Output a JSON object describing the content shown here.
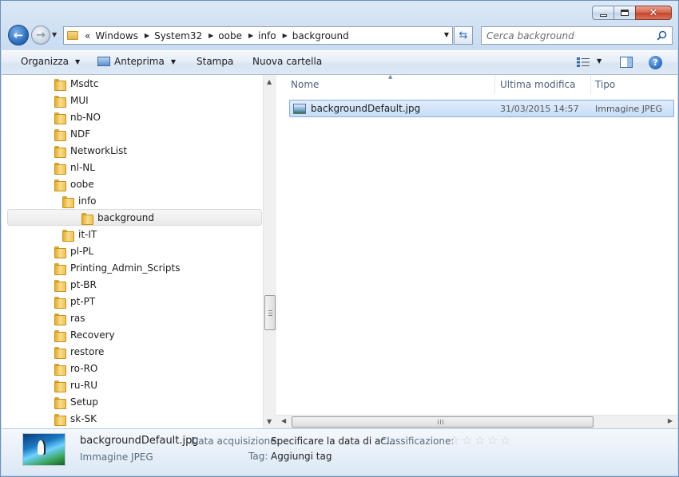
{
  "window": {
    "caption": {
      "minimize": "minimize",
      "maximize": "maximize",
      "close": "✕"
    }
  },
  "address": {
    "overflow": "«",
    "crumbs": [
      "Windows",
      "System32",
      "oobe",
      "info",
      "background"
    ]
  },
  "search": {
    "placeholder": "Cerca background"
  },
  "toolbar": {
    "organize": "Organizza",
    "preview": "Anteprima",
    "print": "Stampa",
    "new_folder": "Nuova cartella"
  },
  "tree": {
    "items": [
      {
        "label": "Msdtc",
        "level": 0
      },
      {
        "label": "MUI",
        "level": 0
      },
      {
        "label": "nb-NO",
        "level": 0
      },
      {
        "label": "NDF",
        "level": 0
      },
      {
        "label": "NetworkList",
        "level": 0
      },
      {
        "label": "nl-NL",
        "level": 0
      },
      {
        "label": "oobe",
        "level": 0
      },
      {
        "label": "info",
        "level": 1
      },
      {
        "label": "background",
        "level": 2,
        "selected": true
      },
      {
        "label": "it-IT",
        "level": 1
      },
      {
        "label": "pl-PL",
        "level": 0
      },
      {
        "label": "Printing_Admin_Scripts",
        "level": 0
      },
      {
        "label": "pt-BR",
        "level": 0
      },
      {
        "label": "pt-PT",
        "level": 0
      },
      {
        "label": "ras",
        "level": 0
      },
      {
        "label": "Recovery",
        "level": 0
      },
      {
        "label": "restore",
        "level": 0
      },
      {
        "label": "ro-RO",
        "level": 0
      },
      {
        "label": "ru-RU",
        "level": 0
      },
      {
        "label": "Setup",
        "level": 0
      },
      {
        "label": "sk-SK",
        "level": 0
      }
    ]
  },
  "list": {
    "columns": {
      "name": "Nome",
      "modified": "Ultima modifica",
      "type": "Tipo"
    },
    "files": [
      {
        "name": "backgroundDefault.jpg",
        "modified": "31/03/2015 14:57",
        "type": "Immagine JPEG"
      }
    ]
  },
  "details": {
    "file_name": "backgroundDefault.jpg",
    "file_type": "Immagine JPEG",
    "acquired_label": "Data acquisizione:",
    "acquired_value": "Specificare la data di ac...",
    "rating_label": "Classificazione:",
    "rating_stars": 0,
    "tags_label": "Tag:",
    "tags_value": "Aggiungi tag"
  },
  "colors": {
    "selection": "#c6ddf7",
    "accent": "#2d6fc0",
    "chrome": "#cddff3"
  }
}
